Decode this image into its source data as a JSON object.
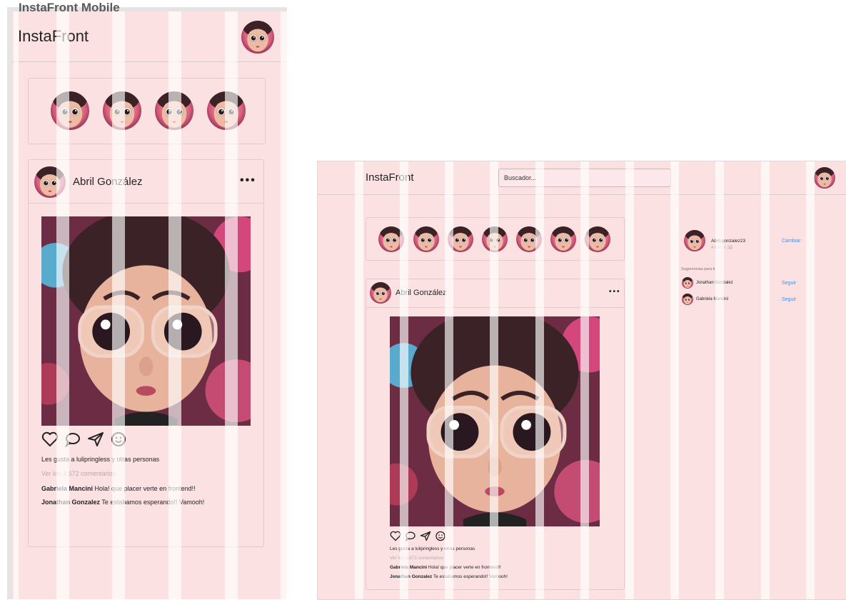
{
  "mobile": {
    "frame_title": "InstaFront Mobile",
    "app_title": "InstaFront",
    "stories_count": 4,
    "post": {
      "username": "Abril González",
      "more_icon": "•••",
      "likes": "Les gusta a lulipringless y otras personas",
      "view_comments": "Ver los 3,672 comentarios",
      "comments": [
        {
          "user": "Gabriela Mancini",
          "text": "Hola! que placer verte en frontend!!"
        },
        {
          "user": "Jonathan Gonzalez",
          "text": "Te estabamos esperando!! Vamooh!"
        }
      ]
    }
  },
  "desktop": {
    "app_title": "InstaFront",
    "search_placeholder": "Buscador...",
    "stories_count": 7,
    "post": {
      "username": "Abril González",
      "more_icon": "•••",
      "likes": "Les gusta a lulipringless y otras personas",
      "view_comments": "Ver los 3,672 comentarios",
      "comments": [
        {
          "user": "Gabriela Mancini",
          "text": "Hola! que placer verte en frontend!!"
        },
        {
          "user": "Jonathan Gonzalez",
          "text": "Te estabamos esperando!! Vamooh!"
        }
      ]
    },
    "sidebar": {
      "username": "Abril.gonzalez23",
      "subname": "A B R I L 🖼",
      "switch_label": "Cambiar",
      "suggestions_title": "Sugerencias para ti",
      "suggestions": [
        {
          "name": "Jonathan Gonzalez",
          "action": "Seguir"
        },
        {
          "name": "Gabriela Mancini",
          "action": "Seguir"
        }
      ]
    }
  },
  "icons": [
    "heart-icon",
    "comment-icon",
    "send-icon",
    "smile-icon",
    "more-icon",
    "avatar"
  ],
  "colors": {
    "frame_bg": "#fce1e3",
    "link": "#4b8fd6",
    "muted": "#b7a9ab"
  }
}
